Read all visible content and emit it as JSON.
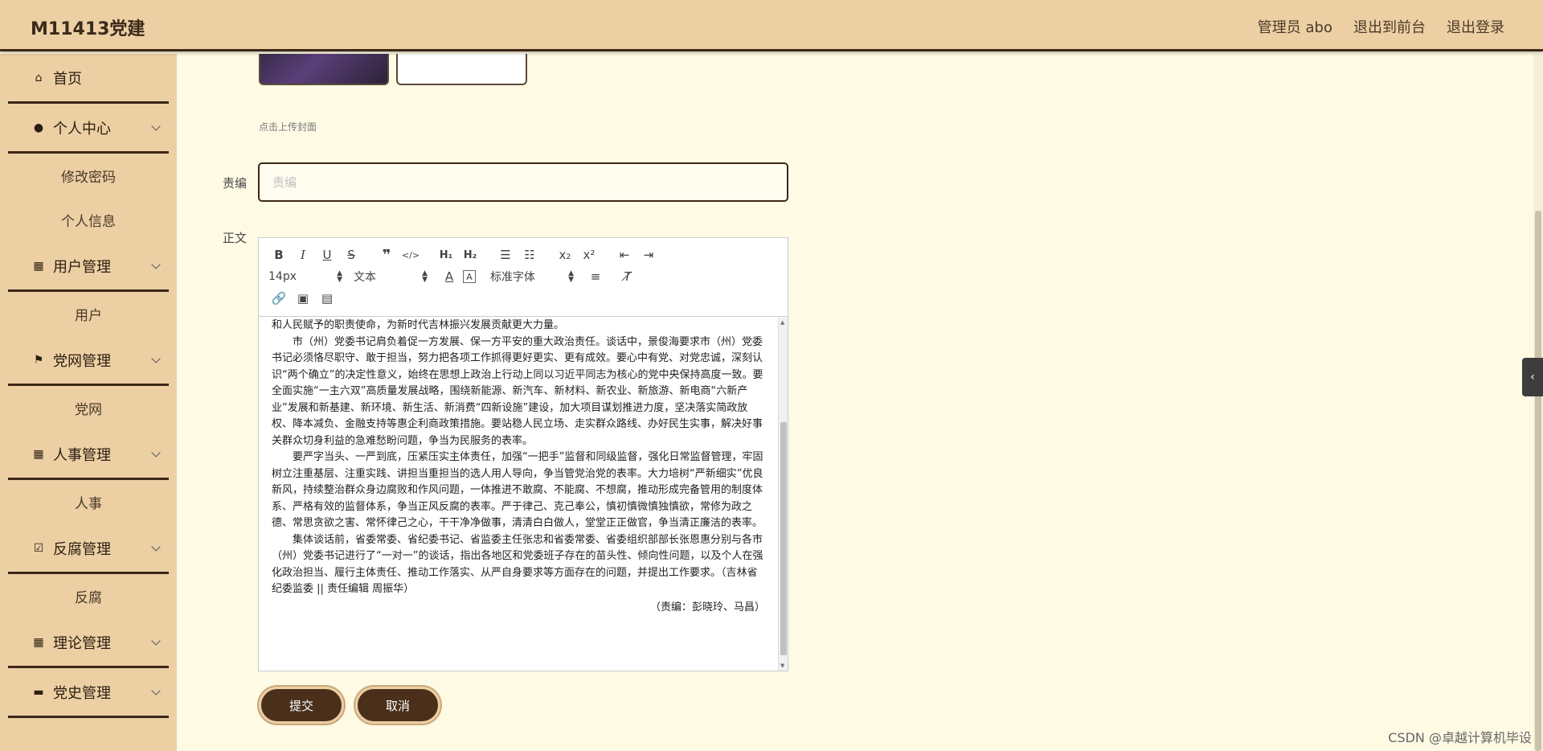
{
  "header": {
    "brand": "M11413党建",
    "admin": "管理员 abo",
    "to_front": "退出到前台",
    "logout": "退出登录"
  },
  "sidebar": {
    "items": [
      {
        "label": "首页",
        "icon": "home-icon"
      },
      {
        "label": "个人中心",
        "icon": "user-icon",
        "subs": [
          "修改密码",
          "个人信息"
        ]
      },
      {
        "label": "用户管理",
        "icon": "grid-icon",
        "subs": [
          "用户"
        ]
      },
      {
        "label": "党网管理",
        "icon": "flag-icon",
        "subs": [
          "党网"
        ]
      },
      {
        "label": "人事管理",
        "icon": "grid-icon",
        "subs": [
          "人事"
        ]
      },
      {
        "label": "反腐管理",
        "icon": "clipboard-check-icon",
        "subs": [
          "反腐"
        ]
      },
      {
        "label": "理论管理",
        "icon": "grid-icon"
      },
      {
        "label": "党史管理",
        "icon": "chat-icon"
      }
    ]
  },
  "form": {
    "upload_hint": "点击上传封面",
    "editor_label": "责编",
    "editor_placeholder": "责编",
    "body_label": "正文",
    "submit": "提交",
    "cancel": "取消"
  },
  "toolbar": {
    "font_size": "14px",
    "block_type": "文本",
    "font_family": "标准字体"
  },
  "content": {
    "p1": "和人民赋予的职责使命，为新时代吉林振兴发展贡献更大力量。",
    "p2": "市（州）党委书记肩负着促一方发展、保一方平安的重大政治责任。谈话中，景俊海要求市（州）党委书记必须恪尽职守、敢于担当，努力把各项工作抓得更好更实、更有成效。要心中有党、对党忠诚，深刻认识“两个确立”的决定性意义，始终在思想上政治上行动上同以习近平同志为核心的党中央保持高度一致。要全面实施“一主六双”高质量发展战略，围绕新能源、新汽车、新材料、新农业、新旅游、新电商“六新产业”发展和新基建、新环境、新生活、新消费“四新设施”建设，加大项目谋划推进力度，坚决落实简政放权、降本减负、金融支持等惠企利商政策措施。要站稳人民立场、走实群众路线、办好民生实事，解决好事关群众切身利益的急难愁盼问题，争当为民服务的表率。",
    "p3": "要严字当头、一严到底，压紧压实主体责任，加强“一把手”监督和同级监督，强化日常监督管理，牢固树立注重基层、注重实践、讲担当重担当的选人用人导向，争当管党治党的表率。大力培树“严新细实”优良新风，持续整治群众身边腐败和作风问题，一体推进不敢腐、不能腐、不想腐，推动形成完备管用的制度体系、严格有效的监督体系，争当正风反腐的表率。严于律己、克己奉公，慎初慎微慎独慎欲，常修为政之德、常思贪欲之害、常怀律己之心，干干净净做事，清清白白做人，堂堂正正做官，争当清正廉洁的表率。",
    "p4": "集体谈话前，省委常委、省纪委书记、省监委主任张忠和省委常委、省委组织部部长张恩惠分别与各市（州）党委书记进行了“一对一”的谈话，指出各地区和党委班子存在的苗头性、倾向性问题，以及个人在强化政治担当、履行主体责任、推动工作落实、从严自身要求等方面存在的问题，并提出工作要求。（吉林省纪委监委 || 责任编辑 周振华）",
    "p5": "（责编：彭晓玲、马昌）"
  },
  "watermark": "CSDN @卓越计算机毕设"
}
